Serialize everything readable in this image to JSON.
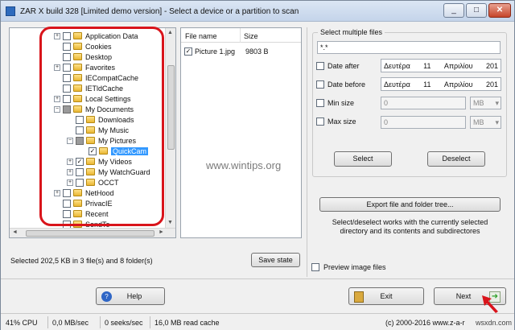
{
  "window": {
    "title": "ZAR X build 328 [Limited demo version] - Select a device or a partition to scan",
    "buttons": {
      "minimize": "_",
      "maximize": "□",
      "close": "✕"
    }
  },
  "tree": {
    "items": [
      {
        "label": "Application Data",
        "expander": "+",
        "check": ""
      },
      {
        "label": "Cookies",
        "expander": "",
        "check": ""
      },
      {
        "label": "Desktop",
        "expander": "",
        "check": ""
      },
      {
        "label": "Favorites",
        "expander": "+",
        "check": ""
      },
      {
        "label": "IECompatCache",
        "expander": "",
        "check": ""
      },
      {
        "label": "IETldCache",
        "expander": "",
        "check": ""
      },
      {
        "label": "Local Settings",
        "expander": "+",
        "check": ""
      },
      {
        "label": "My Documents",
        "expander": "−",
        "check": "partial"
      },
      {
        "label": "Downloads",
        "expander": "",
        "check": ""
      },
      {
        "label": "My Music",
        "expander": "",
        "check": ""
      },
      {
        "label": "My Pictures",
        "expander": "−",
        "check": "partial"
      },
      {
        "label": "QuickCam",
        "expander": "",
        "check": "✓",
        "selected": true
      },
      {
        "label": "My Videos",
        "expander": "+",
        "check": "✓"
      },
      {
        "label": "My WatchGuard",
        "expander": "+",
        "check": ""
      },
      {
        "label": "OCCT",
        "expander": "+",
        "check": ""
      },
      {
        "label": "NetHood",
        "expander": "+",
        "check": ""
      },
      {
        "label": "PrivacIE",
        "expander": "",
        "check": ""
      },
      {
        "label": "Recent",
        "expander": "",
        "check": ""
      },
      {
        "label": "SendTo",
        "expander": "",
        "check": ""
      }
    ]
  },
  "files": {
    "headers": {
      "name": "File name",
      "size": "Size"
    },
    "rows": [
      {
        "check": "✓",
        "name": "Picture 1.jpg",
        "size": "9803 B"
      }
    ]
  },
  "select_multiple": {
    "label": "Select multiple files",
    "pattern": "*.*",
    "date_after": {
      "label": "Date after",
      "day": "Δευτέρα",
      "num": "11",
      "month": "Απριλίου",
      "year": "201"
    },
    "date_before": {
      "label": "Date before",
      "day": "Δευτέρα",
      "num": "11",
      "month": "Απριλίου",
      "year": "201"
    },
    "min_size": {
      "label": "Min size",
      "value": "0",
      "unit": "MB"
    },
    "max_size": {
      "label": "Max size",
      "value": "0",
      "unit": "MB"
    },
    "select_button": "Select",
    "deselect_button": "Deselect"
  },
  "watermark": "www.wintips.org",
  "export_button": "Export file and folder tree...",
  "hint": "Select/deselect works with the currently selected directory and its contents and subdirectores",
  "selected_info": "Selected 202,5 KB in 3 file(s) and 8 folder(s)",
  "save_state": "Save state",
  "preview": {
    "label": "Preview image files"
  },
  "help_button": "Help",
  "exit_button": "Exit",
  "next_button": "Next",
  "status": {
    "cpu": "41% CPU",
    "mbsec": "0,0 MB/sec",
    "seeks": "0 seeks/sec",
    "cache": "16,0 MB read cache",
    "copyright": "(c) 2000-2016 www.z-a-r",
    "brand": "wsxdn.com"
  },
  "colors": {
    "accent": "#3399ff",
    "highlight_box": "#d9141b",
    "next_arrow": "#2fa12a"
  }
}
